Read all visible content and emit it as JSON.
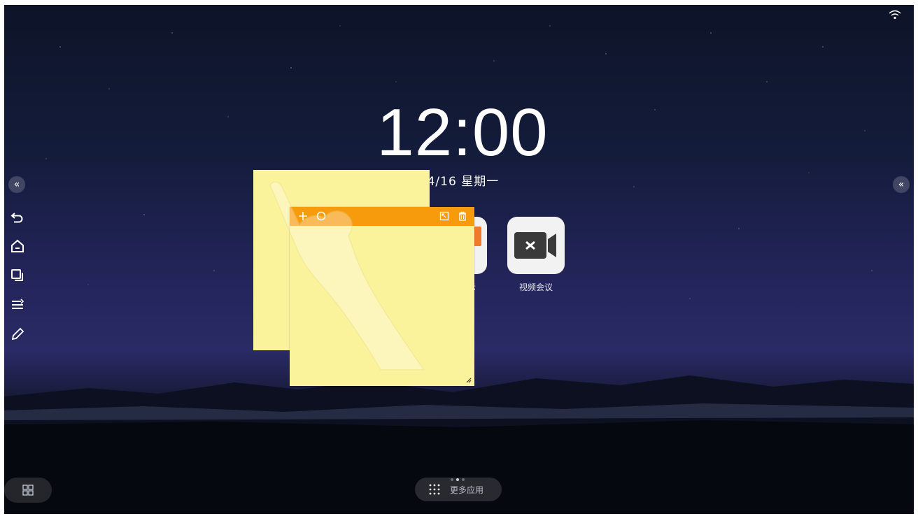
{
  "clock": {
    "time": "12:00",
    "date": "04/16  星期一"
  },
  "apps": [
    {
      "label": "视频会议",
      "icon": "video-conference-icon"
    }
  ],
  "partial_label": "示",
  "dock": {
    "more_apps_label": "更多应用",
    "more_icon": "grid-dots-icon",
    "left_icon": "windows-icon"
  },
  "edge": {
    "left_expand": "«",
    "right_expand": "«"
  },
  "sidebar_tools": [
    "back-icon",
    "home-icon",
    "windows-icon",
    "menu-icon",
    "pen-icon"
  ],
  "pager": {
    "pages": 3,
    "active": 1
  },
  "colors": {
    "note": "#fbf39c",
    "note_bar": "#f79a0c"
  }
}
